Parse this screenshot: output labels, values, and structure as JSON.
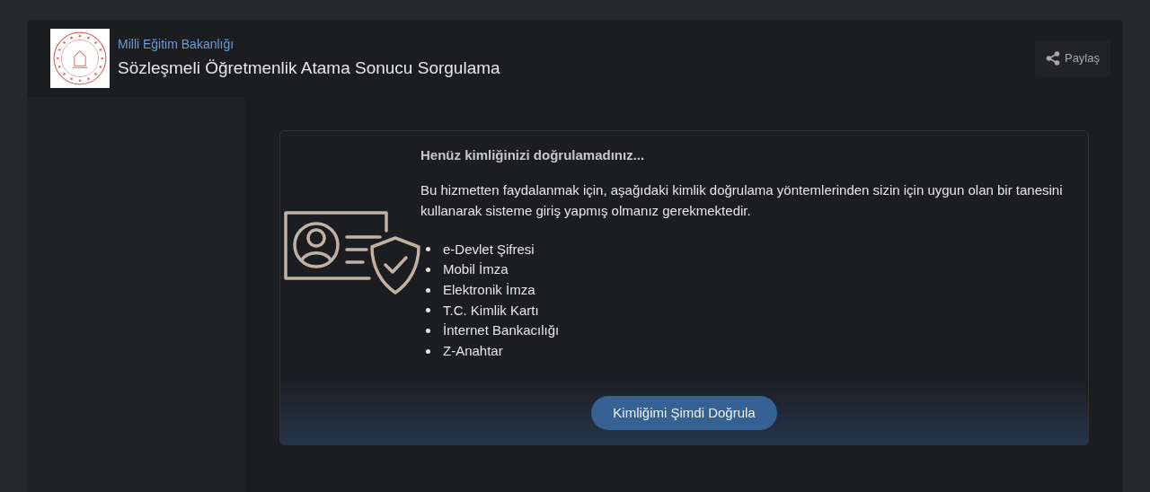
{
  "header": {
    "organization": "Milli Eğitim Bakanlığı",
    "title": "Sözleşmeli Öğretmenlik Atama Sonucu Sorgulama",
    "share_button": "Paylaş"
  },
  "notice": {
    "heading": "Henüz kimliğinizi doğrulamadınız...",
    "body": "Bu hizmetten faydalanmak için, aşağıdaki kimlik doğrulama yöntemlerinden sizin için uygun olan bir tanesini kullanarak sisteme giriş yapmış olmanız gerekmektedir.",
    "methods": [
      "e-Devlet Şifresi",
      "Mobil İmza",
      "Elektronik İmza",
      "T.C. Kimlik Kartı",
      "İnternet Bankacılığı",
      "Z-Anahtar"
    ],
    "button": "Kimliğimi Şimdi Doğrula"
  }
}
